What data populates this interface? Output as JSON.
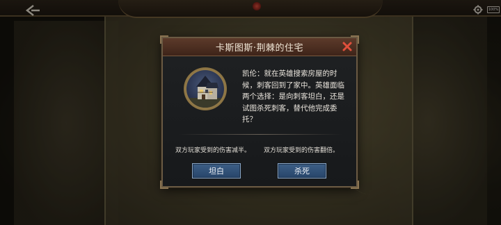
{
  "dialog": {
    "title": "卡斯图斯·荆棘的住宅",
    "story": "凯伦：就在英雄搜索房屋的时候，刺客回到了家中。英雄面临两个选择：是向刺客坦白，还是试图杀死刺客，替代他完成委托？",
    "effects": {
      "left": "双方玩家受到的伤害减半。",
      "right": "双方玩家受到的伤害翻倍。"
    },
    "buttons": {
      "confess": "坦白",
      "kill": "杀死"
    }
  },
  "status": {
    "battery": "100%"
  },
  "colors": {
    "title_bar": "#5c3a2a",
    "button": "#3d5f86",
    "close": "#e0503c"
  },
  "icons": [
    "back-arrow-icon",
    "gear-icon",
    "close-icon",
    "house-portrait-icon"
  ]
}
